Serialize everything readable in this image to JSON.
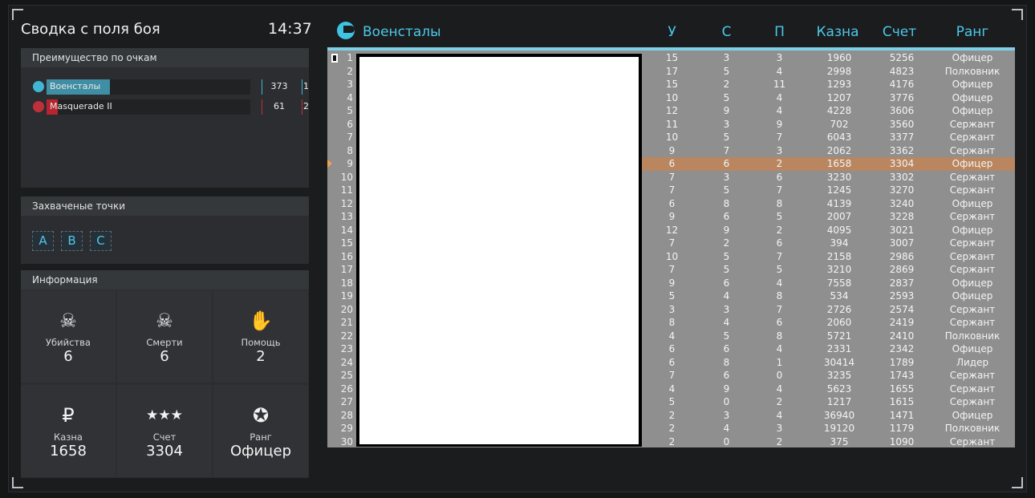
{
  "summary": {
    "title": "Сводка с поля боя",
    "time": "14:37"
  },
  "score_panel": {
    "heading": "Преимущество по очкам",
    "teams": [
      {
        "name": "Военсталы",
        "points": "373",
        "rank": "1",
        "fill": 0.31,
        "color": "#3f8ea3",
        "sep_color": "#3fb6d4"
      },
      {
        "name": "Masquerade II",
        "points": "61",
        "rank": "2",
        "fill": 0.05,
        "color": "#b8242e",
        "sep_color": "#c0303a"
      }
    ]
  },
  "points_panel": {
    "heading": "Захваченые точки",
    "points": [
      "A",
      "B",
      "C"
    ]
  },
  "info_panel": {
    "heading": "Информация",
    "stats": [
      {
        "icon": "skull-icon",
        "glyph": "☠",
        "label": "Убийства",
        "value": "6"
      },
      {
        "icon": "skull-crossbones-icon",
        "glyph": "☠",
        "label": "Смерти",
        "value": "6"
      },
      {
        "icon": "handshake-icon",
        "glyph": "✋",
        "label": "Помощь",
        "value": "2"
      },
      {
        "icon": "ruble-icon",
        "glyph": "₽",
        "label": "Казна",
        "value": "1658"
      },
      {
        "icon": "stars-icon",
        "glyph": "★★★",
        "label": "Счет",
        "value": "3304"
      },
      {
        "icon": "rank-badge-icon",
        "glyph": "✪",
        "label": "Ранг",
        "value": "Офицер"
      }
    ]
  },
  "scoreboard": {
    "team_name": "Военсталы",
    "team_icon": "eagle-icon",
    "columns": [
      "У",
      "С",
      "П",
      "Казна",
      "Счет",
      "Ранг"
    ],
    "highlight_color": "#b98660",
    "highlight_row": 9,
    "rows": [
      [
        "1",
        "15",
        "3",
        "3",
        "1960",
        "5256",
        "Офицер"
      ],
      [
        "2",
        "17",
        "5",
        "4",
        "2998",
        "4823",
        "Полковник"
      ],
      [
        "3",
        "15",
        "2",
        "11",
        "1293",
        "4176",
        "Офицер"
      ],
      [
        "4",
        "10",
        "5",
        "4",
        "1207",
        "3776",
        "Офицер"
      ],
      [
        "5",
        "12",
        "9",
        "4",
        "4228",
        "3606",
        "Офицер"
      ],
      [
        "6",
        "11",
        "3",
        "9",
        "702",
        "3560",
        "Сержант"
      ],
      [
        "7",
        "10",
        "5",
        "7",
        "6043",
        "3377",
        "Сержант"
      ],
      [
        "8",
        "9",
        "7",
        "3",
        "2062",
        "3362",
        "Сержант"
      ],
      [
        "9",
        "6",
        "6",
        "2",
        "1658",
        "3304",
        "Офицер"
      ],
      [
        "10",
        "7",
        "3",
        "6",
        "3230",
        "3302",
        "Сержант"
      ],
      [
        "11",
        "7",
        "5",
        "7",
        "1245",
        "3270",
        "Сержант"
      ],
      [
        "12",
        "6",
        "8",
        "8",
        "4139",
        "3240",
        "Офицер"
      ],
      [
        "13",
        "9",
        "6",
        "5",
        "2007",
        "3228",
        "Сержант"
      ],
      [
        "14",
        "12",
        "9",
        "2",
        "4095",
        "3021",
        "Офицер"
      ],
      [
        "15",
        "7",
        "2",
        "6",
        "394",
        "3007",
        "Сержант"
      ],
      [
        "16",
        "10",
        "5",
        "7",
        "2158",
        "2986",
        "Сержант"
      ],
      [
        "17",
        "7",
        "5",
        "5",
        "3210",
        "2869",
        "Сержант"
      ],
      [
        "18",
        "9",
        "6",
        "4",
        "7558",
        "2837",
        "Офицер"
      ],
      [
        "19",
        "5",
        "4",
        "8",
        "534",
        "2593",
        "Офицер"
      ],
      [
        "20",
        "3",
        "3",
        "7",
        "2726",
        "2574",
        "Сержант"
      ],
      [
        "21",
        "8",
        "4",
        "6",
        "2060",
        "2419",
        "Сержант"
      ],
      [
        "22",
        "4",
        "5",
        "8",
        "5721",
        "2410",
        "Полковник"
      ],
      [
        "23",
        "6",
        "6",
        "4",
        "2331",
        "2342",
        "Офицер"
      ],
      [
        "24",
        "6",
        "8",
        "1",
        "30414",
        "1789",
        "Лидер"
      ],
      [
        "25",
        "7",
        "6",
        "0",
        "3235",
        "1743",
        "Сержант"
      ],
      [
        "26",
        "4",
        "9",
        "4",
        "5623",
        "1655",
        "Сержант"
      ],
      [
        "27",
        "5",
        "0",
        "2",
        "1217",
        "1615",
        "Сержант"
      ],
      [
        "28",
        "2",
        "3",
        "4",
        "36940",
        "1471",
        "Офицер"
      ],
      [
        "29",
        "2",
        "4",
        "3",
        "19120",
        "1179",
        "Полковник"
      ],
      [
        "30",
        "2",
        "0",
        "2",
        "375",
        "1090",
        "Сержант"
      ]
    ]
  }
}
